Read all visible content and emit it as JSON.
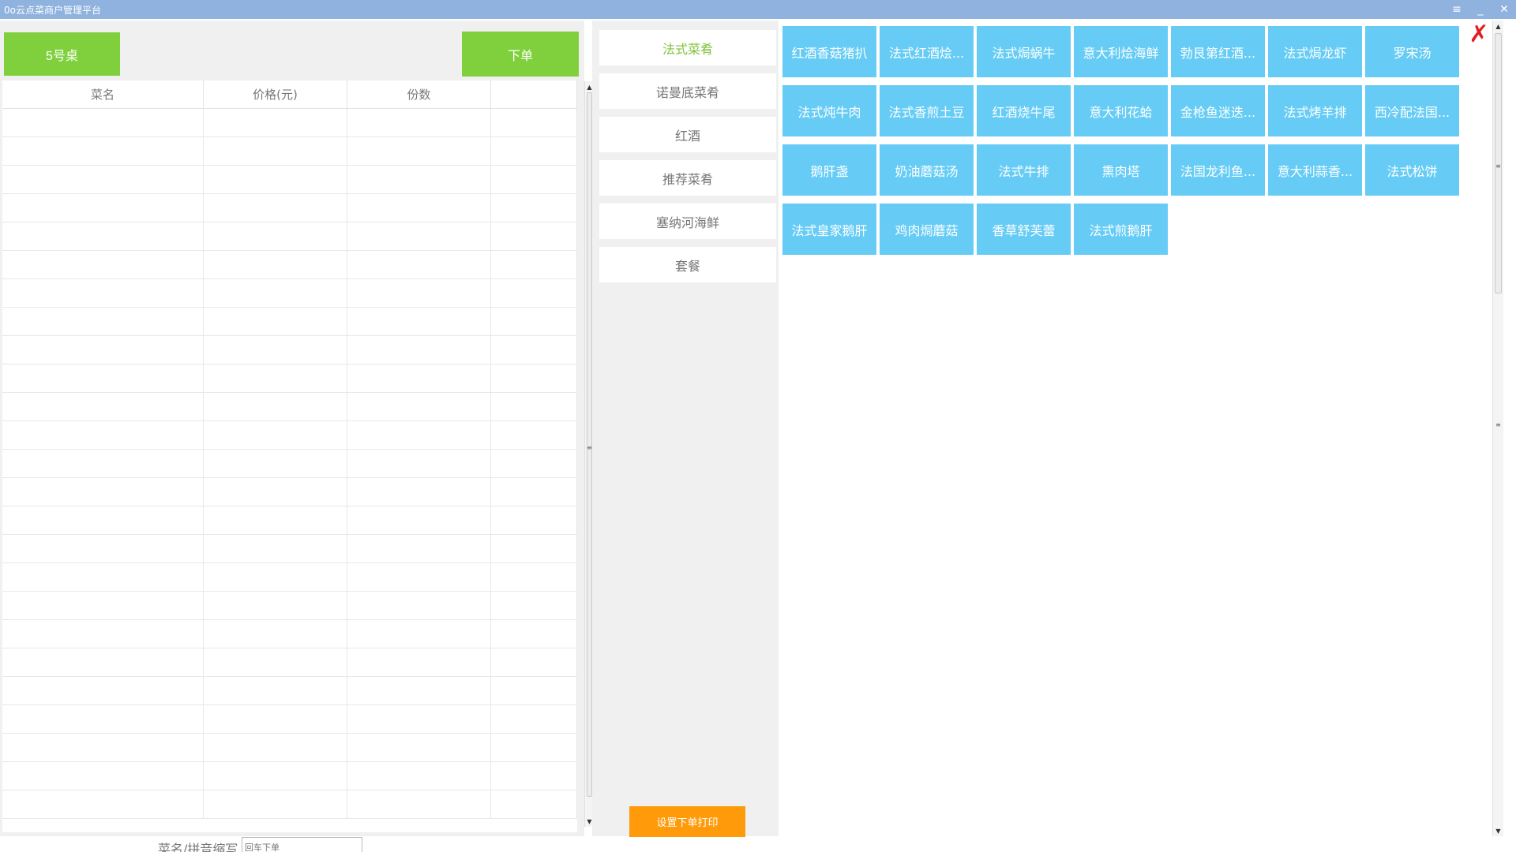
{
  "window": {
    "title": "0o云点菜商户管理平台",
    "menu_icon": "≡",
    "minimize_icon": "_",
    "close_icon": "✕"
  },
  "order": {
    "table_label": "5号桌",
    "submit_label": "下单",
    "columns": [
      "菜名",
      "价格(元)",
      "份数",
      ""
    ],
    "search_label": "菜名/拼音缩写",
    "search_placeholder": "回车下单"
  },
  "categories": {
    "items": [
      "法式菜肴",
      "诺曼底菜肴",
      "红酒",
      "推荐菜肴",
      "塞纳河海鲜",
      "套餐"
    ],
    "active": "法式菜肴",
    "print_label": "设置下单打印",
    "active_color": "#7fc43a"
  },
  "dishes": [
    "红酒香菇猪扒",
    "法式红酒烩...",
    "法式焗蜗牛",
    "意大利烩海鲜",
    "勃艮第红酒...",
    "法式焗龙虾",
    "罗宋汤",
    "法式炖牛肉",
    "法式香煎土豆",
    "红酒烧牛尾",
    "意大利花蛤",
    "金枪鱼迷迭...",
    "法式烤羊排",
    "西冷配法国...",
    "鹅肝盏",
    "奶油蘑菇汤",
    "法式牛排",
    "熏肉塔",
    "法国龙利鱼...",
    "意大利蒜香...",
    "法式松饼",
    "法式皇家鹅肝",
    "鸡肉焗蘑菇",
    "香草舒芙蕾",
    "法式煎鹅肝"
  ],
  "close_icon": "✗",
  "colors": {
    "titlebar": "#8fb2de",
    "green_button": "#7fd03c",
    "dish_tile": "#66ccf5",
    "print_button": "#ff9b0a",
    "close": "#e02020"
  }
}
